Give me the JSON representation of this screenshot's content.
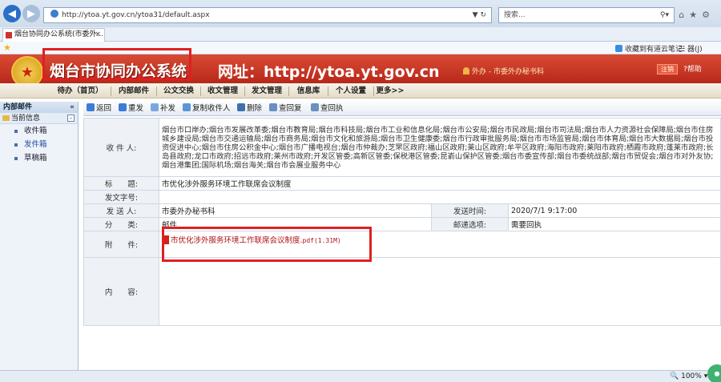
{
  "browser": {
    "url": "http://ytoa.yt.gov.cn/ytoa31/default.aspx",
    "search_placeholder": "搜索...",
    "tab_title": "烟台协同办公系统(市委外...",
    "tab_close": "×",
    "fav_youdao": "收藏到有道云笔记",
    "fav_tools": "器(J)",
    "zoom": "100%"
  },
  "header": {
    "app_title": "烟台市协同办公系统",
    "url_note": "网址：http://ytoa.yt.gov.cn",
    "user_info": "外办 - 市委外办秘书科",
    "logout": "注销",
    "help": "?帮助"
  },
  "nav": [
    "待办（首页）",
    "内部邮件",
    "公文交换",
    "收文管理",
    "发文管理",
    "信息库",
    "个人设置",
    "更多>>"
  ],
  "sidebar": {
    "header": "内部邮件",
    "collapse": "«",
    "section": "当前信息",
    "items": [
      "收件箱",
      "发件箱",
      "草稿箱"
    ]
  },
  "toolbar": [
    "返回",
    "重发",
    "补发",
    "复制收件人",
    "删除",
    "查回复",
    "查回执"
  ],
  "form": {
    "labels": {
      "recipients": "收 件 人:",
      "subject": "标　　题:",
      "doc_no": "发文字号:",
      "sender": "发 送 人:",
      "send_time": "发送时间:",
      "category": "分　　类:",
      "mail_option": "邮递选项:",
      "attachment": "附　　件:",
      "content": "内　　容:"
    },
    "recipients": "烟台市口岸办;烟台市发展改革委;烟台市教育局;烟台市科技局;烟台市工业和信息化局;烟台市公安局;烟台市民政局;烟台市司法局;烟台市人力资源社会保障局;烟台市住房城乡建设局;烟台市交通运输局;烟台市商务局;烟台市文化和旅游局;烟台市卫生健康委;烟台市行政审批服务局;烟台市市场监管局;烟台市体育局;烟台市大数据局;烟台市投资促进中心;烟台市住房公积金中心;烟台市广播电视台;烟台市仲裁办;芝罘区政府;福山区政府;莱山区政府;牟平区政府;海阳市政府;莱阳市政府;栖霞市政府;蓬莱市政府;长岛县政府;龙口市政府;招远市政府;莱州市政府;开发区管委;高新区管委;保税港区管委;昆嵛山保护区管委;烟台市委宣传部;烟台市委统战部;烟台市贸促会;烟台市对外友协;烟台港集团;国际机场;烟台海关;烟台市会展业服务中心",
    "subject": "市优化涉外服务环境工作联席会议制度",
    "doc_no": "",
    "sender": "市委外办秘书科",
    "send_time": "2020/7/1 9:17:00",
    "category": "邮件",
    "mail_option": "需要回执",
    "attachment_name": "市优化涉外服务环境工作联席会议制度.",
    "attachment_ext": "pdf",
    "attachment_size": "(1.31M)",
    "content": ""
  }
}
